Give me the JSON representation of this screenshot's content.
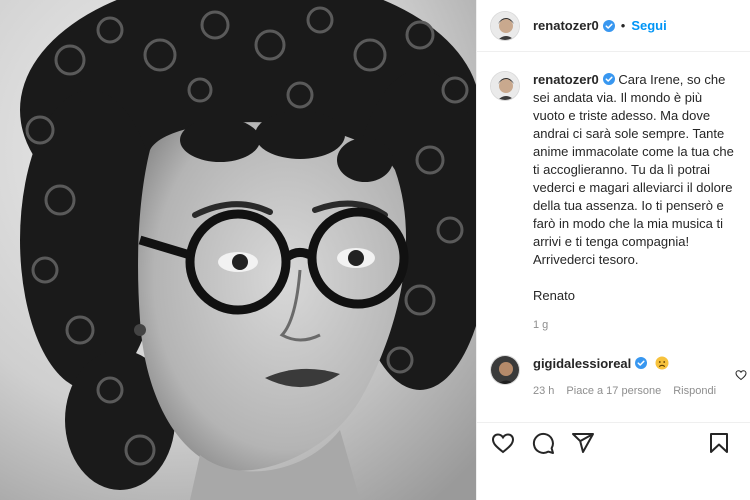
{
  "header": {
    "username": "renatozer0",
    "separator": "•",
    "follow_label": "Segui"
  },
  "caption": {
    "username": "renatozer0",
    "text": "Cara Irene, so che sei andata via. Il mondo è più vuoto e triste adesso. Ma dove andrai ci sarà sole sempre. Tante anime immacolate come la tua che ti accoglieranno. Tu da lì potrai vederci e magari alleviarci il dolore della tua assenza. Io ti penserò e farò in modo che la mia musica ti arrivi e ti tenga compagnia! Arrivederci tesoro.",
    "signature": "Renato",
    "time": "1 g"
  },
  "comment": {
    "username": "gigidalessioreal",
    "emoji": "sad-face-emoji",
    "time": "23 h",
    "likes_label": "Piace a 17 persone",
    "reply_label": "Rispondi"
  },
  "icons": {
    "like": "heart-icon",
    "comment": "comment-icon",
    "share": "share-icon",
    "save": "bookmark-icon",
    "verified": "verified-badge-icon"
  },
  "colors": {
    "link": "#0095f6",
    "verified": "#3897f0",
    "text": "#262626",
    "muted": "#8e8e8e"
  }
}
